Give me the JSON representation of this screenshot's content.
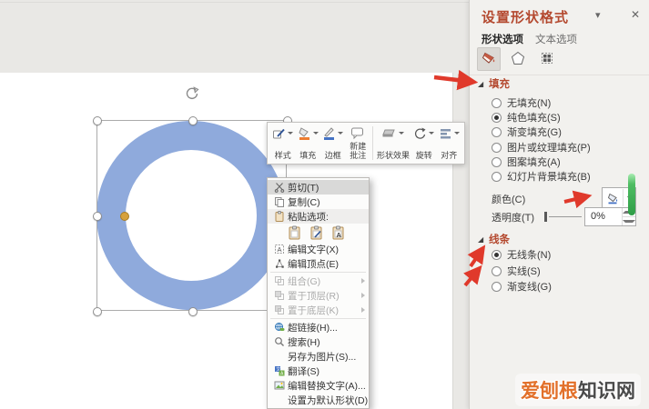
{
  "panel": {
    "title": "设置形状格式",
    "collapse_icon": "▾",
    "close_icon": "✕",
    "tabs": [
      {
        "label": "形状选项"
      },
      {
        "label": "文本选项"
      }
    ],
    "fill_section": {
      "marker": "◢",
      "header": "填充",
      "options": [
        {
          "label": "无填充(N)",
          "selected": false
        },
        {
          "label": "纯色填充(S)",
          "selected": true
        },
        {
          "label": "渐变填充(G)",
          "selected": false
        },
        {
          "label": "图片或纹理填充(P)",
          "selected": false
        },
        {
          "label": "图案填充(A)",
          "selected": false
        },
        {
          "label": "幻灯片背景填充(B)",
          "selected": false
        }
      ],
      "color_label": "颜色(C)",
      "transparency_label": "透明度(T)",
      "transparency_value": "0%"
    },
    "line_section": {
      "marker": "◢",
      "header": "线条",
      "options": [
        {
          "label": "无线条(N)",
          "selected": true
        },
        {
          "label": "实线(S)",
          "selected": false
        },
        {
          "label": "渐变线(G)",
          "selected": false
        }
      ]
    }
  },
  "mini_toolbar": {
    "items": [
      {
        "label": "样式",
        "icon": "style-icon",
        "dropdown": true
      },
      {
        "label": "填充",
        "icon": "fill-icon",
        "dropdown": true
      },
      {
        "label": "边框",
        "icon": "border-icon",
        "dropdown": true
      },
      {
        "label": "新建批注",
        "icon": "new-comment-icon",
        "dropdown": false
      },
      {
        "label": "形状效果",
        "icon": "shape-effects-icon",
        "dropdown": true
      },
      {
        "label": "旋转",
        "icon": "rotate-icon",
        "dropdown": true
      },
      {
        "label": "对齐",
        "icon": "align-icon",
        "dropdown": true
      }
    ]
  },
  "context_menu": {
    "items": [
      {
        "label": "剪切(T)",
        "icon": "scissors-icon",
        "highlighted": true
      },
      {
        "label": "复制(C)",
        "icon": "copy-icon"
      },
      {
        "label": "粘贴选项:",
        "icon": "clipboard-icon"
      },
      {
        "type": "paste-options"
      },
      {
        "label": "编辑文字(X)",
        "icon": "edit-text-icon"
      },
      {
        "label": "编辑顶点(E)",
        "icon": "edit-points-icon"
      },
      {
        "type": "divider"
      },
      {
        "label": "组合(G)",
        "icon": "group-icon",
        "disabled": true,
        "submenu": true
      },
      {
        "label": "置于顶层(R)",
        "icon": "bring-to-front-icon",
        "disabled": true,
        "submenu": true
      },
      {
        "label": "置于底层(K)",
        "icon": "send-to-back-icon",
        "disabled": true,
        "submenu": true
      },
      {
        "type": "divider"
      },
      {
        "label": "超链接(H)...",
        "icon": "hyperlink-icon"
      },
      {
        "label": "搜索(H)",
        "icon": "search-icon"
      },
      {
        "label": "另存为图片(S)..."
      },
      {
        "label": "翻译(S)",
        "icon": "translate-icon"
      },
      {
        "label": "编辑替换文字(A)...",
        "icon": "alt-text-icon"
      },
      {
        "label": "设置为默认形状(D)"
      }
    ]
  },
  "canvas": {
    "shape": "donut",
    "fill_color": "#8faadc"
  },
  "watermark": {
    "highlight": "爱刨根",
    "rest": "知识网"
  },
  "colors": {
    "annotation_arrow": "#e0392b",
    "panel_accent": "#b4492f",
    "scrollbar_green": "#2f9e47",
    "watermark_orange": "#e2702a"
  }
}
